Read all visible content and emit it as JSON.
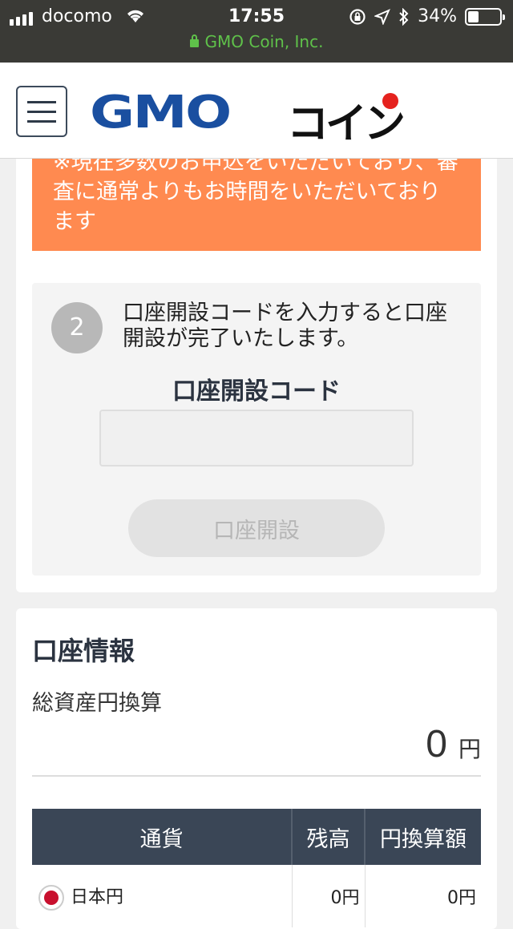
{
  "status_bar": {
    "carrier": "docomo",
    "time": "17:55",
    "battery": "34%",
    "battery_level": 0.34,
    "url": "GMO Coin, Inc."
  },
  "header": {
    "logo_text": "GMO",
    "logo_kana": "コイン"
  },
  "notice": {
    "text": "※現在多数のお申込をいただいており、審査に通常よりもお時間をいただいております"
  },
  "step": {
    "number": "2",
    "instruction": "口座開設コードを入力すると口座開設が完了いたします。",
    "code_label": "口座開設コード",
    "code_value": "",
    "code_placeholder": "",
    "button_label": "口座開設"
  },
  "account": {
    "title": "口座情報",
    "total_label": "総資産円換算",
    "total_value": "0",
    "total_unit": "円",
    "table": {
      "headers": [
        "通貨",
        "残高",
        "円換算額"
      ],
      "rows": [
        {
          "currency": "日本円",
          "balance": "0円",
          "yen_value": "0円"
        }
      ]
    }
  },
  "colors": {
    "notice_bg": "#ff8a50",
    "brand_blue": "#1a4fa0",
    "table_header": "#3a4656",
    "url_green": "#5fc14a"
  }
}
